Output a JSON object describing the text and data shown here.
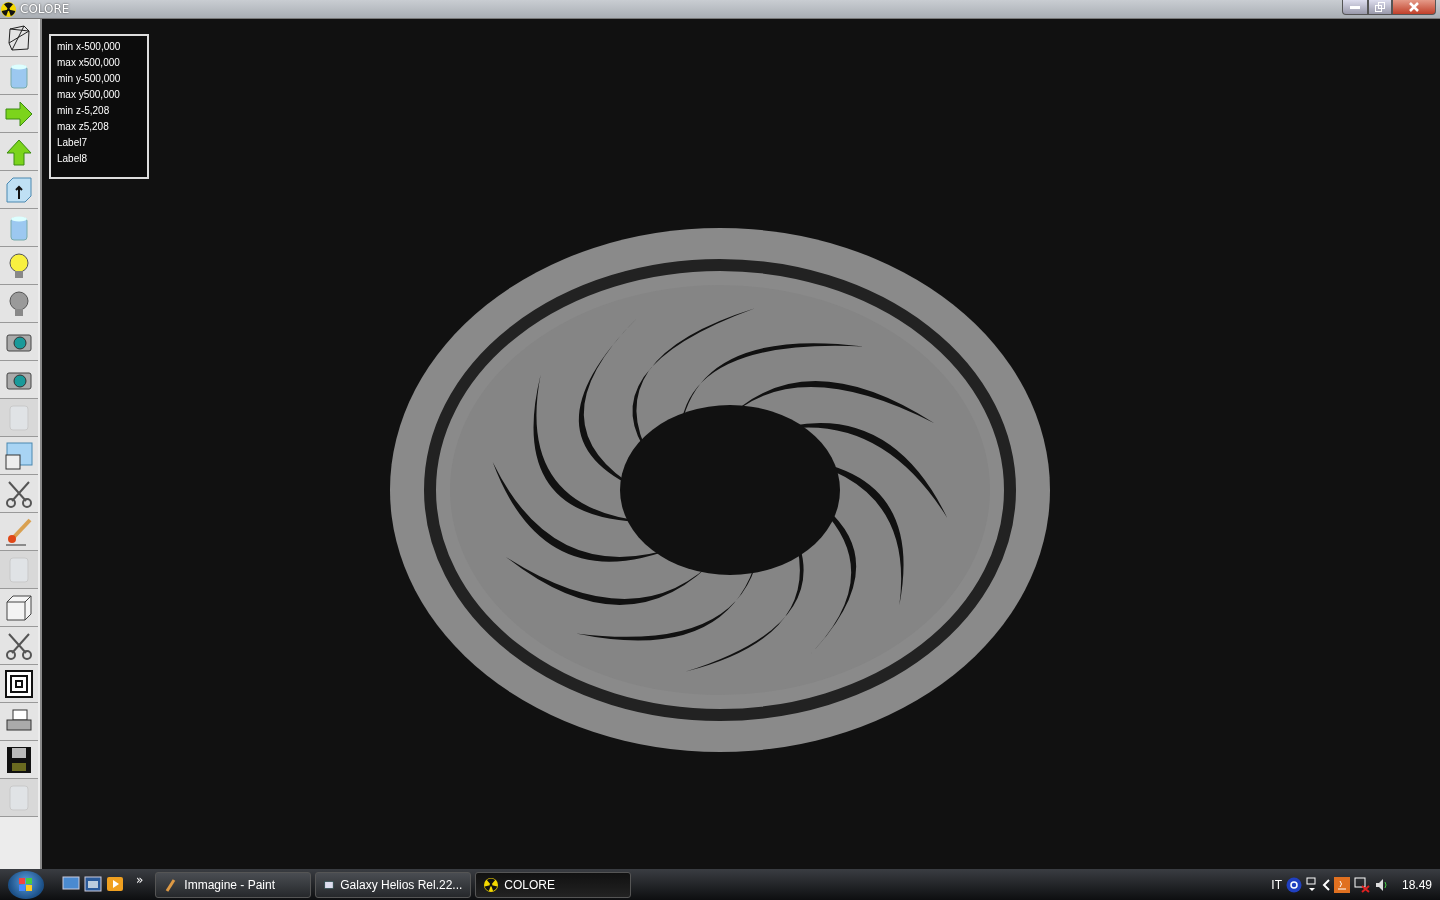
{
  "window": {
    "title": "COLORE"
  },
  "toolbar": [
    {
      "kind": "wireframe",
      "disabled": false
    },
    {
      "kind": "cylinder",
      "disabled": false
    },
    {
      "kind": "arrow-right",
      "disabled": false
    },
    {
      "kind": "arrow-up",
      "disabled": false
    },
    {
      "kind": "cube-up",
      "disabled": false
    },
    {
      "kind": "cylinder",
      "disabled": false
    },
    {
      "kind": "bulb-on",
      "disabled": false
    },
    {
      "kind": "bulb-off",
      "disabled": false
    },
    {
      "kind": "camera",
      "disabled": false
    },
    {
      "kind": "camera",
      "disabled": false
    },
    {
      "kind": "glass",
      "disabled": true
    },
    {
      "kind": "panes",
      "disabled": false
    },
    {
      "kind": "scissors",
      "disabled": false
    },
    {
      "kind": "brush",
      "disabled": false
    },
    {
      "kind": "glass",
      "disabled": true
    },
    {
      "kind": "cube",
      "disabled": false
    },
    {
      "kind": "scissors",
      "disabled": false
    },
    {
      "kind": "squares",
      "disabled": false
    },
    {
      "kind": "printer",
      "disabled": false
    },
    {
      "kind": "floppy",
      "disabled": false
    },
    {
      "kind": "glass",
      "disabled": true
    }
  ],
  "info_box": [
    "min x-500,000",
    "max x500,000",
    "min y-500,000",
    "max y500,000",
    "min z-5,208",
    "max z5,208",
    "Label7",
    "Label8"
  ],
  "taskbar": {
    "more": "»",
    "tasks": [
      {
        "label": "Immagine - Paint",
        "kind": "paint",
        "selected": false
      },
      {
        "label": "Galaxy Helios  Rel.22...",
        "kind": "window",
        "selected": false
      },
      {
        "label": "COLORE",
        "kind": "radiation",
        "selected": true
      }
    ],
    "language": "IT",
    "clock": "18.49"
  }
}
